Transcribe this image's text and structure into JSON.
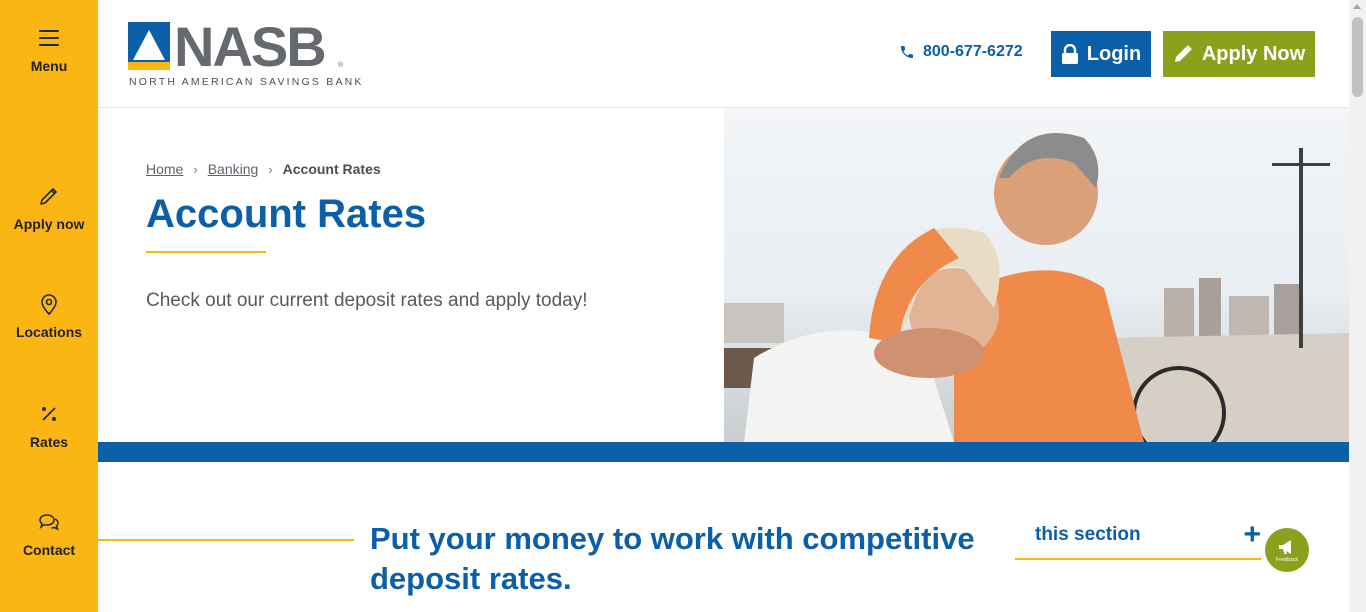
{
  "sidebar": {
    "items": [
      {
        "label": "Menu",
        "icon": "menu-icon"
      },
      {
        "label": "Apply now",
        "icon": "pencil-icon"
      },
      {
        "label": "Locations",
        "icon": "location-pin-icon"
      },
      {
        "label": "Rates",
        "icon": "percent-icon"
      },
      {
        "label": "Contact",
        "icon": "chat-icon"
      }
    ]
  },
  "header": {
    "logo_word": "NASB",
    "logo_reg": "®",
    "logo_sub": "NORTH AMERICAN SAVINGS BANK",
    "phone": "800-677-6272",
    "login_label": "Login",
    "apply_label": "Apply Now"
  },
  "hero": {
    "breadcrumb": {
      "home": "Home",
      "banking": "Banking",
      "current": "Account Rates"
    },
    "title": "Account Rates",
    "subtitle": "Check out our current deposit rates and apply today!"
  },
  "section": {
    "title": "Put your money to work with competitive deposit rates.",
    "toggle_label": "this section",
    "toggle_icon": "+"
  },
  "feedback": {
    "label": "Feedback"
  },
  "colors": {
    "brand_blue": "#0b5ea8",
    "brand_yellow": "#fbb614",
    "brand_green": "#8aa21b"
  }
}
